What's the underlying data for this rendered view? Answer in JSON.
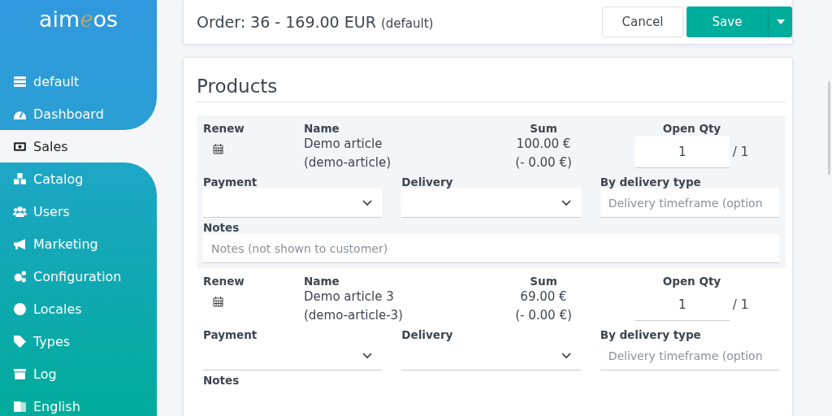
{
  "sidebar": {
    "logo": {
      "before": "aim",
      "accent": "e",
      "after": "os"
    },
    "items": [
      {
        "label": "default",
        "selected": false
      },
      {
        "label": "Dashboard",
        "selected": false
      },
      {
        "label": "Sales",
        "selected": true
      },
      {
        "label": "Catalog",
        "selected": false
      },
      {
        "label": "Users",
        "selected": false
      },
      {
        "label": "Marketing",
        "selected": false
      },
      {
        "label": "Configuration",
        "selected": false
      },
      {
        "label": "Locales",
        "selected": false
      },
      {
        "label": "Types",
        "selected": false
      },
      {
        "label": "Log",
        "selected": false
      },
      {
        "label": "English",
        "selected": false
      }
    ]
  },
  "header": {
    "title": "Order: 36 - 169.00 EUR",
    "site": "(default)",
    "cancel": "Cancel",
    "save": "Save"
  },
  "products": {
    "title": "Products",
    "items": [
      {
        "labels": {
          "renew": "Renew",
          "name": "Name",
          "sum": "Sum",
          "qty": "Open Qty",
          "payment": "Payment",
          "delivery": "Delivery",
          "bytype": "By delivery type",
          "notes": "Notes"
        },
        "name": "Demo article",
        "code": "(demo-article)",
        "price": "100.00 €",
        "rebate": "(- 0.00 €)",
        "qty": "1",
        "total": "/ 1",
        "timeframe_placeholder": "Delivery timeframe (option",
        "notes_placeholder": "Notes (not shown to customer)"
      },
      {
        "labels": {
          "renew": "Renew",
          "name": "Name",
          "sum": "Sum",
          "qty": "Open Qty",
          "payment": "Payment",
          "delivery": "Delivery",
          "bytype": "By delivery type",
          "notes": "Notes"
        },
        "name": "Demo article 3",
        "code": "(demo-article-3)",
        "price": "69.00 €",
        "rebate": "(- 0.00 €)",
        "qty": "1",
        "total": "/ 1",
        "timeframe_placeholder": "Delivery timeframe (option"
      }
    ]
  }
}
